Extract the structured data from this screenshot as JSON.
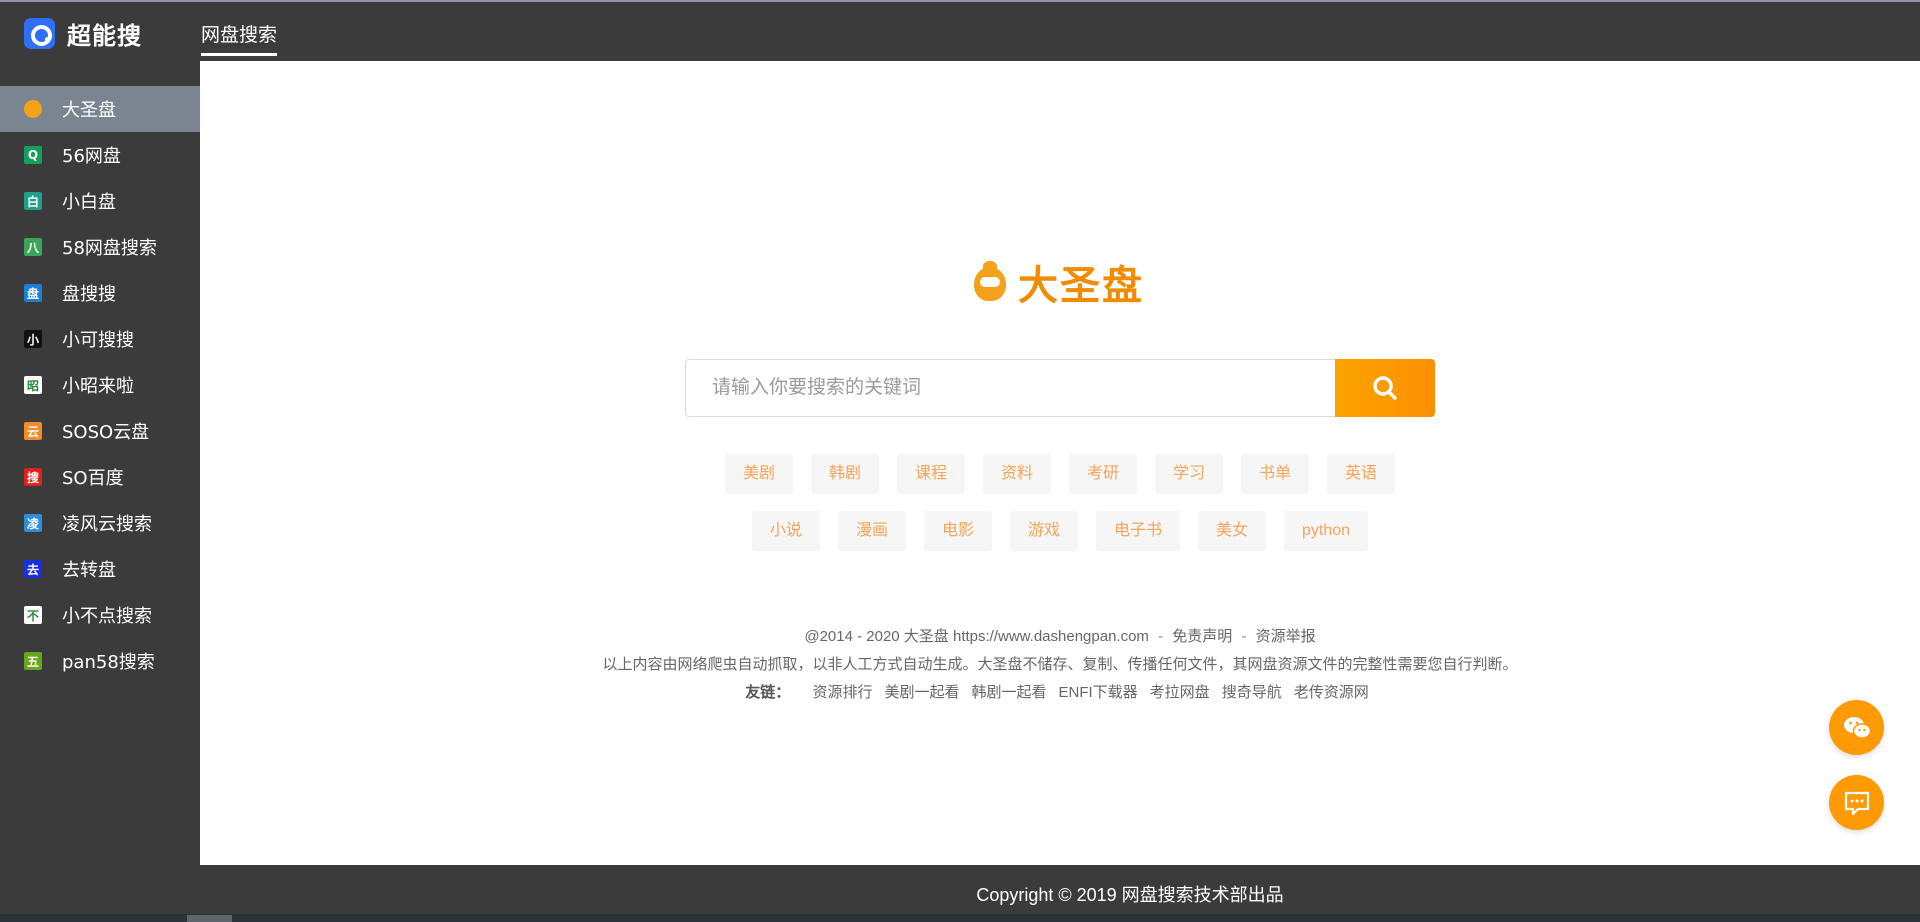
{
  "app": {
    "name": "超能搜",
    "top_tab": "网盘搜索"
  },
  "sidebar": {
    "items": [
      {
        "label": "大圣盘",
        "icon": "monkey-icon",
        "color": "#f3a21a",
        "glyph": ""
      },
      {
        "label": "56网盘",
        "icon": "magnifier-icon",
        "color": "#17a05d",
        "glyph": "Q"
      },
      {
        "label": "小白盘",
        "icon": "bai-icon",
        "color": "#1f9e8a",
        "glyph": "白"
      },
      {
        "label": "58网盘搜索",
        "icon": "ba-icon",
        "color": "#3aa657",
        "glyph": "八"
      },
      {
        "label": "盘搜搜",
        "icon": "pan-icon",
        "color": "#1e7fd6",
        "glyph": "盘"
      },
      {
        "label": "小可搜搜",
        "icon": "xiao-icon",
        "color": "#111111",
        "glyph": "小"
      },
      {
        "label": "小昭来啦",
        "icon": "zhao-icon",
        "color": "#ffffff",
        "glyph": "昭"
      },
      {
        "label": "SOSO云盘",
        "icon": "yun-icon",
        "color": "#f08a2b",
        "glyph": "云"
      },
      {
        "label": "SO百度",
        "icon": "sou-icon",
        "color": "#e0201b",
        "glyph": "搜"
      },
      {
        "label": "凌风云搜索",
        "icon": "ling-icon",
        "color": "#2a8ed8",
        "glyph": "凌"
      },
      {
        "label": "去转盘",
        "icon": "qu-icon",
        "color": "#1b2fe0",
        "glyph": "去"
      },
      {
        "label": "小不点搜索",
        "icon": "bu-icon",
        "color": "#ffffff",
        "glyph": "不"
      },
      {
        "label": "pan58搜索",
        "icon": "wu-icon",
        "color": "#6aa51e",
        "glyph": "五"
      }
    ]
  },
  "main": {
    "logo_text": "大圣盘",
    "search": {
      "placeholder": "请输入你要搜索的关键词",
      "value": ""
    },
    "tags_row1": [
      "美剧",
      "韩剧",
      "课程",
      "资料",
      "考研",
      "学习",
      "书单",
      "英语"
    ],
    "tags_row2": [
      "小说",
      "漫画",
      "电影",
      "游戏",
      "电子书",
      "美女",
      "python"
    ],
    "footer": {
      "copyright_prefix": "@2014 - 2020 大圣盘 https://www.dashengpan.com",
      "sep": "-",
      "disclaimer_link": "免责声明",
      "report_link": "资源举报",
      "notice": "以上内容由网络爬虫自动抓取，以非人工方式自动生成。大圣盘不储存、复制、传播任何文件，其网盘资源文件的完整性需要您自行判断。",
      "friends_label": "友链：",
      "friends": [
        "资源排行",
        "美剧一起看",
        "韩剧一起看",
        "ENFI下载器",
        "考拉网盘",
        "搜奇导航",
        "老传资源网"
      ]
    }
  },
  "bottom": {
    "copyright": "Copyright © 2019 网盘搜索技术部出品"
  },
  "colors": {
    "accent": "#fd9a05",
    "dark": "#3b3b3b",
    "active_item": "#7b8591",
    "tag_text": "#f5a45a"
  }
}
